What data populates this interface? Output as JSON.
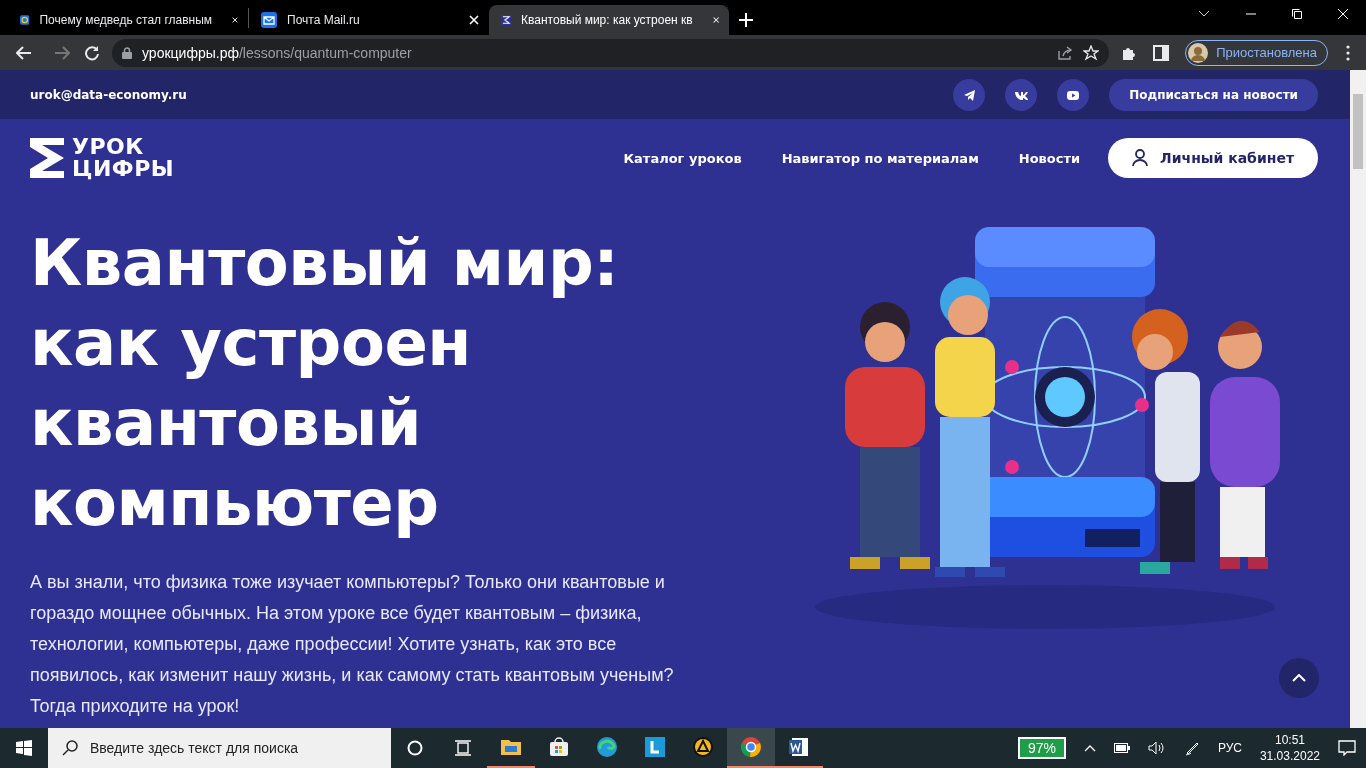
{
  "browser": {
    "tabs": [
      {
        "title": "Почему медведь стал главным",
        "selected": false
      },
      {
        "title": "Почта Mail.ru",
        "selected": false
      },
      {
        "title": "Квантовый мир: как устроен кв",
        "selected": true
      }
    ],
    "address": {
      "host": "урокцифры.рф",
      "path": "/lessons/quantum-computer"
    },
    "profile": {
      "label": "Приостановлена"
    }
  },
  "site": {
    "email": "urok@data-economy.ru",
    "subscribe": "Подписаться на новости",
    "logo": {
      "line1": "УРОК",
      "line2": "ЦИФРЫ"
    },
    "nav": [
      "Каталог уроков",
      "Навигатор по материалам",
      "Новости"
    ],
    "account": "Личный кабинет",
    "title_lines": [
      "Квантовый мир:",
      "как устроен",
      "квантовый",
      "компьютер"
    ],
    "intro": "А вы знали, что физика тоже изучает компьютеры? Только они квантовые и гораздо мощнее обычных. На этом уроке все будет квантовым – физика, технологии, компьютеры, даже профессии! Хотите узнать, как это все появилось, как изменит нашу жизнь, и как самому стать квантовым ученым? Тогда приходите на урок!"
  },
  "taskbar": {
    "search_placeholder": "Введите здесь текст для поиска",
    "apps": [
      {
        "kind": "explorer",
        "running": true,
        "selected": false
      },
      {
        "kind": "store",
        "running": false,
        "selected": false
      },
      {
        "kind": "edge",
        "running": false,
        "selected": false
      },
      {
        "kind": "l",
        "running": false,
        "selected": false
      },
      {
        "kind": "triangle",
        "running": false,
        "selected": false
      },
      {
        "kind": "chrome",
        "running": true,
        "selected": true
      },
      {
        "kind": "word",
        "running": true,
        "selected": false
      }
    ],
    "battery": "97%",
    "language": "РУС",
    "time": "10:51",
    "date": "31.03.2022"
  }
}
